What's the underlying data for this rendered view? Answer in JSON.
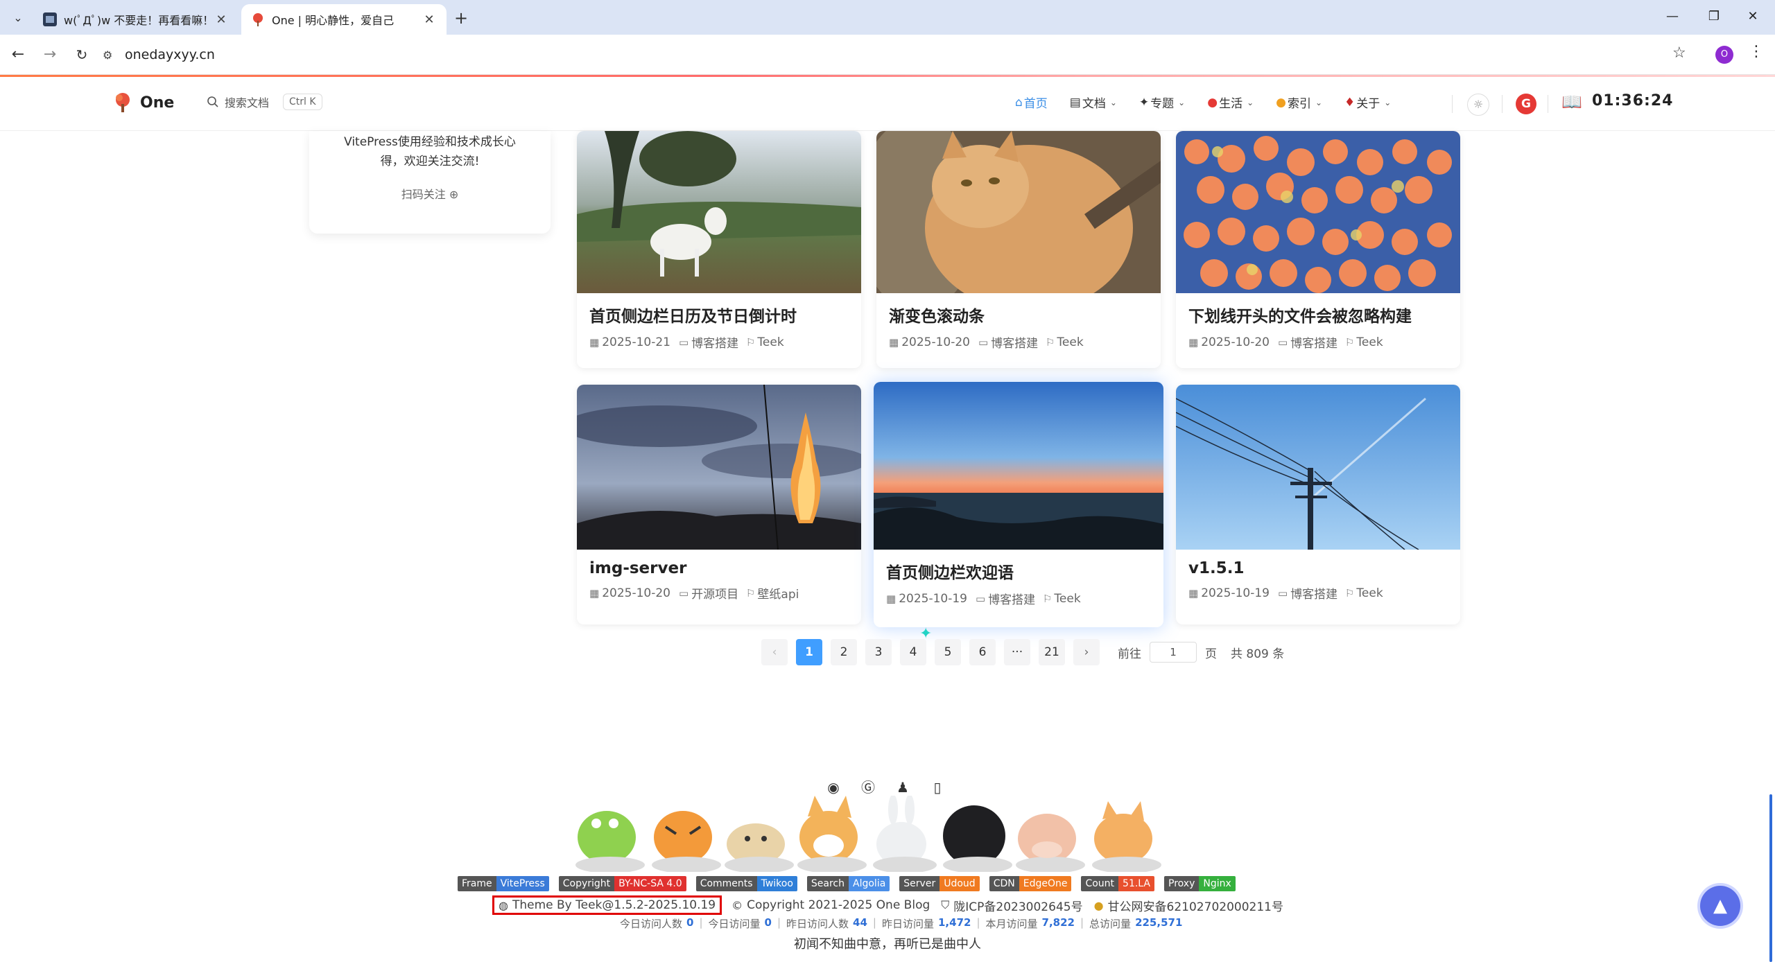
{
  "browser": {
    "tabs": [
      {
        "title": "w(ﾟДﾟ)w 不要走！再看看嘛！",
        "active": false
      },
      {
        "title": "One | 明心静性，爱自己",
        "active": true
      }
    ],
    "url": "onedayxyy.cn",
    "profile_initial": "O"
  },
  "header": {
    "logo_text": "One",
    "search_label": "搜索文档",
    "search_shortcut": "Ctrl K",
    "menu": [
      {
        "label": "首页",
        "icon": "home-icon",
        "active": true,
        "dropdown": false
      },
      {
        "label": "文档",
        "icon": "doc-icon",
        "active": false,
        "dropdown": true
      },
      {
        "label": "专题",
        "icon": "topic-icon",
        "active": false,
        "dropdown": true
      },
      {
        "label": "生活",
        "icon": "life-icon",
        "active": false,
        "dropdown": true
      },
      {
        "label": "索引",
        "icon": "index-icon",
        "active": false,
        "dropdown": true
      },
      {
        "label": "关于",
        "icon": "about-icon",
        "active": false,
        "dropdown": true
      }
    ],
    "clock": "01:36:24"
  },
  "sidebar_card": {
    "description": "VitePress使用经验和技术成长心得，欢迎关注交流!",
    "follow_label": "扫码关注"
  },
  "posts": [
    {
      "title": "首页侧边栏日历及节日倒计时",
      "date": "2025-10-21",
      "category": "博客搭建",
      "tag": "Teek"
    },
    {
      "title": "渐变色滚动条",
      "date": "2025-10-20",
      "category": "博客搭建",
      "tag": "Teek"
    },
    {
      "title": "下划线开头的文件会被忽略构建",
      "date": "2025-10-20",
      "category": "博客搭建",
      "tag": "Teek"
    },
    {
      "title": "img-server",
      "date": "2025-10-20",
      "category": "开源项目",
      "tag": "壁纸api"
    },
    {
      "title": "首页侧边栏欢迎语",
      "date": "2025-10-19",
      "category": "博客搭建",
      "tag": "Teek"
    },
    {
      "title": "v1.5.1",
      "date": "2025-10-19",
      "category": "博客搭建",
      "tag": "Teek"
    }
  ],
  "pagination": {
    "pages": [
      "1",
      "2",
      "3",
      "4",
      "5",
      "6",
      "···",
      "21"
    ],
    "current": "1",
    "goto_label": "前往",
    "goto_value": "1",
    "unit": "页",
    "total": "共 809 条"
  },
  "footer": {
    "badges": [
      {
        "key": "Frame",
        "value": "VitePress",
        "color": "#3b7bd8"
      },
      {
        "key": "Copyright",
        "value": "BY-NC-SA 4.0",
        "color": "#e0312f"
      },
      {
        "key": "Comments",
        "value": "Twikoo",
        "color": "#2f7fd8"
      },
      {
        "key": "Search",
        "value": "Algolia",
        "color": "#4b8fe8"
      },
      {
        "key": "Server",
        "value": "Udoud",
        "color": "#f07a20"
      },
      {
        "key": "CDN",
        "value": "EdgeOne",
        "color": "#f07a20"
      },
      {
        "key": "Count",
        "value": "51.LA",
        "color": "#e8502e"
      },
      {
        "key": "Proxy",
        "value": "Nginx",
        "color": "#35b03d"
      }
    ],
    "theme": "Theme By Teek@1.5.2-2025.10.19",
    "copyright": "Copyright 2021-2025 One Blog",
    "icp": "陇ICP备2023002645号",
    "police": "甘公网安备62102702000211号",
    "stats": [
      {
        "label": "今日访问人数",
        "value": "0"
      },
      {
        "label": "今日访问量",
        "value": "0"
      },
      {
        "label": "昨日访问人数",
        "value": "44"
      },
      {
        "label": "昨日访问量",
        "value": "1,472"
      },
      {
        "label": "本月访问量",
        "value": "7,822"
      },
      {
        "label": "总访问量",
        "value": "225,571"
      }
    ],
    "motto": "初闻不知曲中意，再听已是曲中人"
  }
}
